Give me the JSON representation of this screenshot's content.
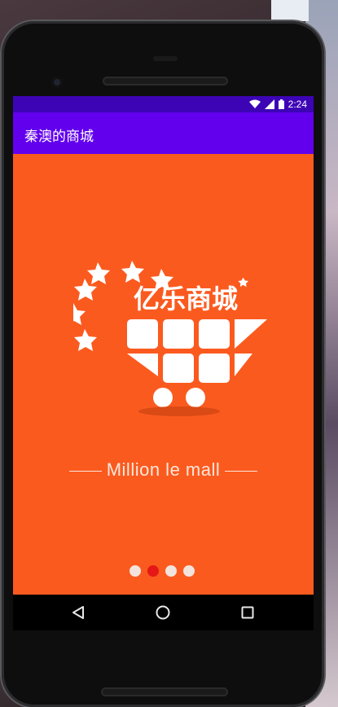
{
  "status_bar": {
    "time": "2:24",
    "icons": [
      "wifi-icon",
      "signal-icon",
      "battery-icon"
    ]
  },
  "app_bar": {
    "title": "秦澳的商城"
  },
  "splash": {
    "logo_text": "亿乐商城",
    "tagline": "Million le mall"
  },
  "pager": {
    "count": 4,
    "active_index": 1
  },
  "nav_bar": {
    "buttons": [
      "back-icon",
      "home-icon",
      "recents-icon"
    ]
  },
  "colors": {
    "status_bar": "#3d04b6",
    "app_bar": "#6200ee",
    "splash_bg": "#fb5a1f",
    "dot_active": "#e51717",
    "dot_inactive": "#f2e4dd"
  }
}
